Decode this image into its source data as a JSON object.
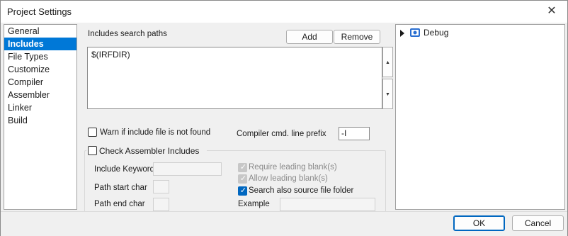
{
  "window": {
    "title": "Project Settings"
  },
  "sidebar": {
    "items": [
      {
        "label": "General",
        "selected": false
      },
      {
        "label": "Includes",
        "selected": true
      },
      {
        "label": "File Types",
        "selected": false
      },
      {
        "label": "Customize",
        "selected": false
      },
      {
        "label": "Compiler",
        "selected": false
      },
      {
        "label": "Assembler",
        "selected": false
      },
      {
        "label": "Linker",
        "selected": false
      },
      {
        "label": "Build",
        "selected": false
      }
    ]
  },
  "includes": {
    "search_paths_label": "Includes search paths",
    "add_label": "Add",
    "remove_label": "Remove",
    "paths_value": "$(IRFDIR)",
    "warn_label": "Warn if include file is not found",
    "warn_checked": false,
    "prefix_label": "Compiler cmd. line prefix",
    "prefix_value": "-I",
    "check_asm_label": "Check Assembler Includes",
    "check_asm_checked": false,
    "include_keyword_label": "Include Keyword",
    "path_start_label": "Path start char",
    "path_end_label": "Path end char",
    "require_blank_label": "Require leading blank(s)",
    "allow_blank_label": "Allow leading blank(s)",
    "search_source_label": "Search also source file folder",
    "search_source_checked": true,
    "example_label": "Example"
  },
  "tree": {
    "items": [
      {
        "label": "Debug",
        "icon": "debug-config-icon"
      }
    ]
  },
  "footer": {
    "ok_label": "OK",
    "cancel_label": "Cancel"
  }
}
